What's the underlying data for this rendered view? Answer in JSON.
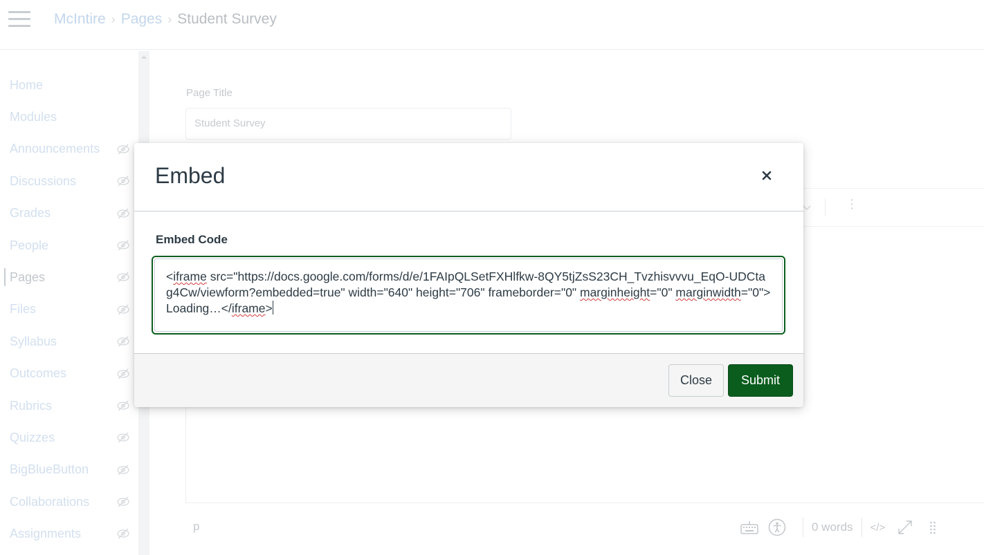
{
  "breadcrumb": {
    "course": "McIntire",
    "section": "Pages",
    "current": "Student Survey"
  },
  "sidebar": {
    "items": [
      {
        "label": "Home",
        "hidden_icon": false,
        "active": false
      },
      {
        "label": "Modules",
        "hidden_icon": false,
        "active": false
      },
      {
        "label": "Announcements",
        "hidden_icon": true,
        "active": false
      },
      {
        "label": "Discussions",
        "hidden_icon": true,
        "active": false
      },
      {
        "label": "Grades",
        "hidden_icon": true,
        "active": false
      },
      {
        "label": "People",
        "hidden_icon": true,
        "active": false
      },
      {
        "label": "Pages",
        "hidden_icon": true,
        "active": true
      },
      {
        "label": "Files",
        "hidden_icon": true,
        "active": false
      },
      {
        "label": "Syllabus",
        "hidden_icon": true,
        "active": false
      },
      {
        "label": "Outcomes",
        "hidden_icon": true,
        "active": false
      },
      {
        "label": "Rubrics",
        "hidden_icon": true,
        "active": false
      },
      {
        "label": "Quizzes",
        "hidden_icon": true,
        "active": false
      },
      {
        "label": "BigBlueButton",
        "hidden_icon": true,
        "active": false
      },
      {
        "label": "Collaborations",
        "hidden_icon": true,
        "active": false
      },
      {
        "label": "Assignments",
        "hidden_icon": true,
        "active": false
      }
    ]
  },
  "page_form": {
    "title_label": "Page Title",
    "title_value": "Student Survey"
  },
  "editor": {
    "path": "p",
    "word_count": "0 words",
    "html_toggle": "</>"
  },
  "modal": {
    "title": "Embed",
    "field_label": "Embed Code",
    "embed_code": "<iframe src=\"https://docs.google.com/forms/d/e/1FAIpQLSetFXHlfkw-8QY5tjZsS23CH_Tvzhisvvvu_EqO-UDCtag4Cw/viewform?embedded=true\" width=\"640\" height=\"706\" frameborder=\"0\" marginheight=\"0\" marginwidth=\"0\">Loading…</iframe>",
    "close_label": "Close",
    "submit_label": "Submit"
  },
  "colors": {
    "primary_green": "#0b5d1e",
    "text_dark": "#2d3b45",
    "border_gray": "#c7cdd1",
    "spellcheck_red": "#d63b3b"
  },
  "icons": {
    "hamburger": "hamburger-icon",
    "eye_hidden": "eye-slash-icon",
    "close": "close-icon",
    "keyboard": "keyboard-icon",
    "accessibility": "accessibility-icon",
    "fullscreen": "fullscreen-icon",
    "drag": "drag-handle-icon"
  }
}
